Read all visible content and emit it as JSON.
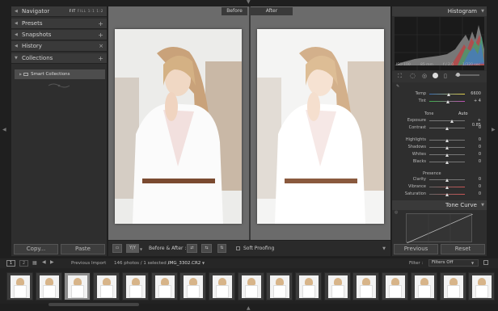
{
  "left_panel": {
    "navigator": {
      "label": "Navigator",
      "options": [
        "FIT",
        "FILL",
        "1:1",
        "1:2"
      ]
    },
    "presets": {
      "label": "Presets"
    },
    "snapshots": {
      "label": "Snapshots"
    },
    "history": {
      "label": "History"
    },
    "collections": {
      "label": "Collections",
      "items": [
        {
          "label": "Smart Collections"
        }
      ]
    },
    "copy_button": "Copy...",
    "paste_button": "Paste"
  },
  "center": {
    "before_label": "Before",
    "after_label": "After"
  },
  "toolbar": {
    "view_mode_label": "Y|Y",
    "before_after_label": "Before & After :",
    "soft_proofing_label": "Soft Proofing"
  },
  "right_panel": {
    "histogram": {
      "label": "Histogram",
      "iso": "ISO 100",
      "focal": "85 mm",
      "aperture": "f / 2.0",
      "shutter": "1/320 sec"
    },
    "basic": {
      "temp": {
        "label": "Temp",
        "value": "6600",
        "fraction": 0.55
      },
      "tint": {
        "label": "Tint",
        "value": "+ 4",
        "fraction": 0.52
      },
      "tone_label": "Tone",
      "auto_label": "Auto",
      "exposure": {
        "label": "Exposure",
        "value": "+ 0.85",
        "fraction": 0.64
      },
      "contrast": {
        "label": "Contrast",
        "value": "0",
        "fraction": 0.5
      },
      "highlights": {
        "label": "Highlights",
        "value": "0",
        "fraction": 0.5
      },
      "shadows": {
        "label": "Shadows",
        "value": "0",
        "fraction": 0.5
      },
      "whites": {
        "label": "Whites",
        "value": "0",
        "fraction": 0.5
      },
      "blacks": {
        "label": "Blacks",
        "value": "0",
        "fraction": 0.5
      },
      "presence_label": "Presence",
      "clarity": {
        "label": "Clarity",
        "value": "0",
        "fraction": 0.5
      },
      "vibrance": {
        "label": "Vibrance",
        "value": "0",
        "fraction": 0.5
      },
      "saturation": {
        "label": "Saturation",
        "value": "0",
        "fraction": 0.5
      }
    },
    "tone_curve": {
      "label": "Tone Curve"
    },
    "previous_button": "Previous",
    "reset_button": "Reset"
  },
  "filmstrip_bar": {
    "monitor1": "1",
    "monitor2": "2",
    "source": "Previous Import",
    "info": "146 photos / 1 selected /",
    "filename": "IMG_3302.CR2",
    "filter_label": "Filter :",
    "filter_value": "Filters Off"
  },
  "filmstrip": {
    "count": 17,
    "selected_index": 2
  }
}
